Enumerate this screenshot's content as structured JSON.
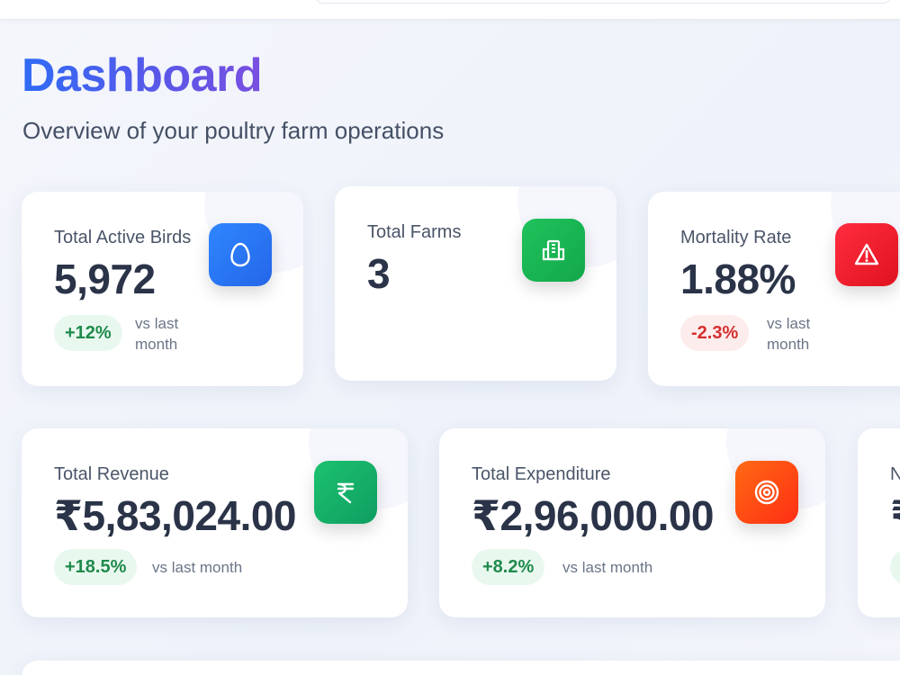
{
  "header": {
    "title": "Dashboard",
    "subtitle": "Overview of your poultry farm operations"
  },
  "cards": {
    "active_birds": {
      "label": "Total Active Birds",
      "value": "5,972",
      "change": "+12%",
      "vs_line1": "vs last",
      "vs_line2": "month",
      "icon": "egg-icon",
      "color": "#2f6bf5"
    },
    "farms": {
      "label": "Total Farms",
      "value": "3",
      "icon": "building-icon",
      "color": "#16b653"
    },
    "mortality": {
      "label": "Mortality Rate",
      "value": "1.88%",
      "change": "-2.3%",
      "vs_line1": "vs last",
      "vs_line2": "month",
      "icon": "warning-icon",
      "color": "#ef1d2b"
    },
    "revenue": {
      "label": "Total Revenue",
      "value": "₹5,83,024.00",
      "change": "+18.5%",
      "vs": "vs last month",
      "icon": "rupee-icon",
      "color": "#12ac66"
    },
    "expenditure": {
      "label": "Total Expenditure",
      "value": "₹2,96,000.00",
      "change": "+8.2%",
      "vs": "vs last month",
      "icon": "target-icon",
      "color": "#ff4a13"
    },
    "partial": {
      "label": "N",
      "value": "₹"
    }
  },
  "colors": {
    "positive": "#1f8a4c",
    "negative": "#d32f2f"
  }
}
